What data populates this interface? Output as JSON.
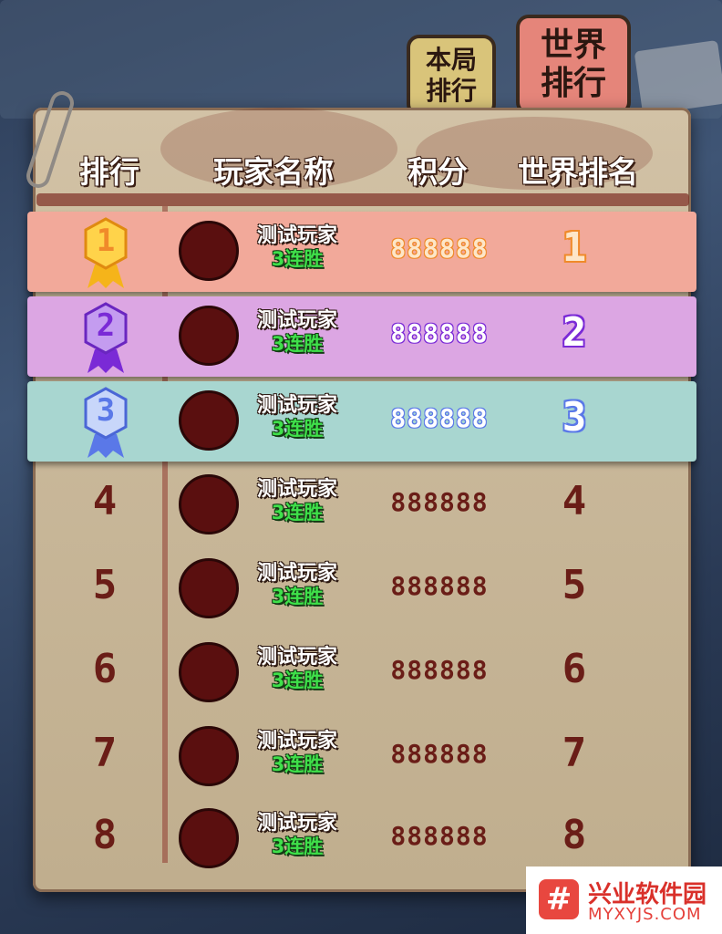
{
  "tabs": {
    "round": {
      "line1": "本局",
      "line2": "排行"
    },
    "world": {
      "line1": "世界",
      "line2": "排行"
    }
  },
  "headers": {
    "rank": "排行",
    "player_name": "玩家名称",
    "score": "积分",
    "world_rank": "世界排名"
  },
  "rows": [
    {
      "rank": "1",
      "name": "测试玩家",
      "streak": "3连胜",
      "score": "888888",
      "world_rank": "1"
    },
    {
      "rank": "2",
      "name": "测试玩家",
      "streak": "3连胜",
      "score": "888888",
      "world_rank": "2"
    },
    {
      "rank": "3",
      "name": "测试玩家",
      "streak": "3连胜",
      "score": "888888",
      "world_rank": "3"
    },
    {
      "rank": "4",
      "name": "测试玩家",
      "streak": "3连胜",
      "score": "888888",
      "world_rank": "4"
    },
    {
      "rank": "5",
      "name": "测试玩家",
      "streak": "3连胜",
      "score": "888888",
      "world_rank": "5"
    },
    {
      "rank": "6",
      "name": "测试玩家",
      "streak": "3连胜",
      "score": "888888",
      "world_rank": "6"
    },
    {
      "rank": "7",
      "name": "测试玩家",
      "streak": "3连胜",
      "score": "888888",
      "world_rank": "7"
    },
    {
      "rank": "8",
      "name": "测试玩家",
      "streak": "3连胜",
      "score": "888888",
      "world_rank": "8"
    }
  ],
  "colors": {
    "gold_band": "#f2a99a",
    "purple_band": "#dca6e3",
    "teal_band": "#a8d6d0",
    "gold_text": "#f08a2a",
    "purple_text": "#7a2ad6",
    "blue_text": "#5a78e8",
    "default_text": "#6a1d17"
  },
  "watermark": {
    "logo": "#",
    "title": "兴业软件园",
    "url": "MYXYJS.COM"
  }
}
